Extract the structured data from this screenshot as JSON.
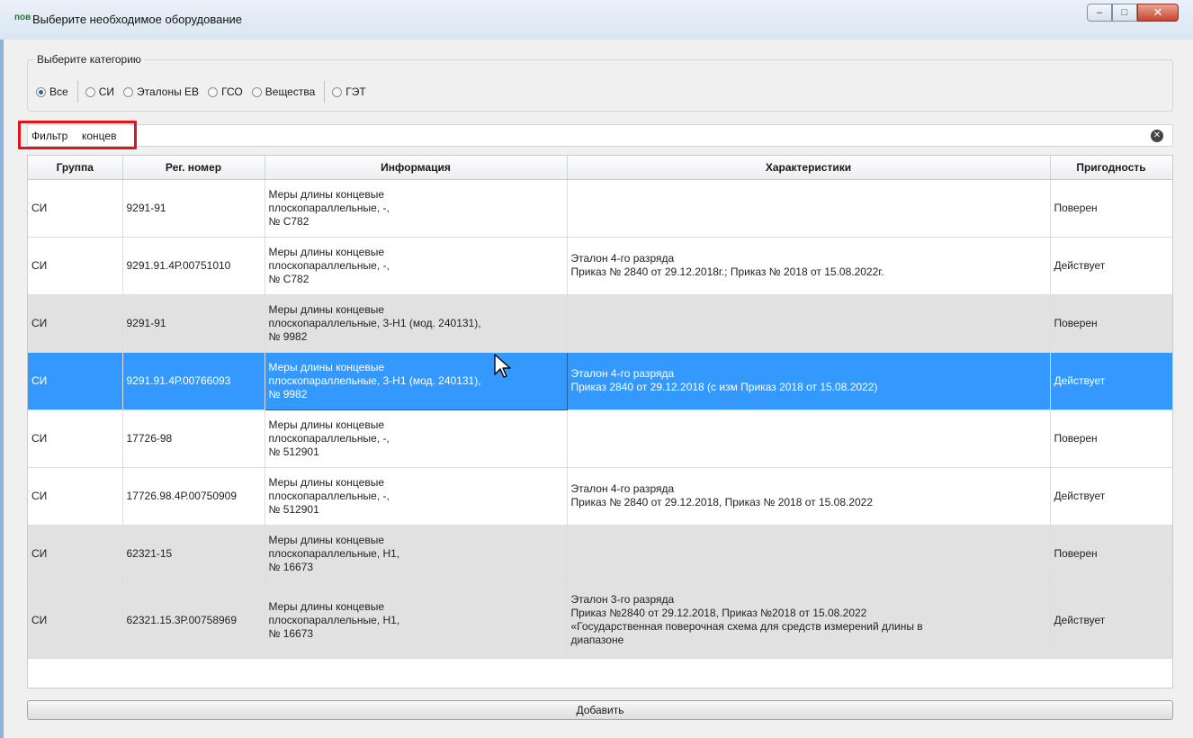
{
  "window": {
    "logo": "пов",
    "title": "Выберите необходимое оборудование",
    "minimize_glyph": "–",
    "maximize_glyph": "□",
    "close_glyph": "✕"
  },
  "category": {
    "legend": "Выберите категорию",
    "options": [
      "Все",
      "СИ",
      "Эталоны ЕВ",
      "ГСО",
      "Вещества",
      "ГЭТ"
    ],
    "selected": "Все"
  },
  "filter": {
    "label": "Фильтр",
    "value": "концев",
    "clear_glyph": "✕"
  },
  "table": {
    "headers": [
      "Группа",
      "Рег. номер",
      "Информация",
      "Характеристики",
      "Пригодность"
    ],
    "rows": [
      {
        "group": "СИ",
        "reg": "9291-91",
        "info": "Меры длины концевые\nплоскопараллельные, -,\n№ С782",
        "chars": "",
        "status": "Поверен"
      },
      {
        "group": "СИ",
        "reg": "9291.91.4Р.00751010",
        "info": "Меры длины концевые\nплоскопараллельные, -,\n№ С782",
        "chars": "Эталон 4-го разряда\nПриказ № 2840 от 29.12.2018г.;  Приказ № 2018 от 15.08.2022г.",
        "status": "Действует"
      },
      {
        "group": "СИ",
        "reg": "9291-91",
        "info": "Меры длины концевые\nплоскопараллельные, 3-Н1 (мод. 240131),\n№ 9982",
        "chars": "",
        "status": "Поверен"
      },
      {
        "group": "СИ",
        "reg": "9291.91.4Р.00766093",
        "info": "Меры длины концевые\nплоскопараллельные, 3-Н1 (мод. 240131),\n№ 9982",
        "chars": "Эталон 4-го разряда\nПриказ 2840 от 29.12.2018 (с изм Приказ 2018 от 15.08.2022)",
        "status": "Действует"
      },
      {
        "group": "СИ",
        "reg": "17726-98",
        "info": "Меры длины концевые\nплоскопараллельные, -,\n№ 512901",
        "chars": "",
        "status": "Поверен"
      },
      {
        "group": "СИ",
        "reg": "17726.98.4Р.00750909",
        "info": "Меры длины концевые\nплоскопараллельные, -,\n№ 512901",
        "chars": "Эталон 4-го разряда\nПриказ № 2840 от 29.12.2018, Приказ № 2018 от 15.08.2022",
        "status": "Действует"
      },
      {
        "group": "СИ",
        "reg": "62321-15",
        "info": "Меры длины концевые\nплоскопараллельные, Н1,\n№ 16673",
        "chars": "",
        "status": "Поверен"
      },
      {
        "group": "СИ",
        "reg": "62321.15.3Р.00758969",
        "info": "Меры длины концевые\nплоскопараллельные, Н1,\n№ 16673",
        "chars": "Эталон 3-го разряда\nПриказ №2840 от 29.12.2018, Приказ №2018 от 15.08.2022\n«Государственная поверочная схема для средств измерений длины в\nдиапазоне",
        "status": "Действует"
      }
    ],
    "selected_row": 3
  },
  "footer": {
    "add_label": "Добавить"
  },
  "colors": {
    "selection": "#3399ff",
    "alt_row": "#e1e1e1",
    "highlight_frame": "#e3131b"
  }
}
